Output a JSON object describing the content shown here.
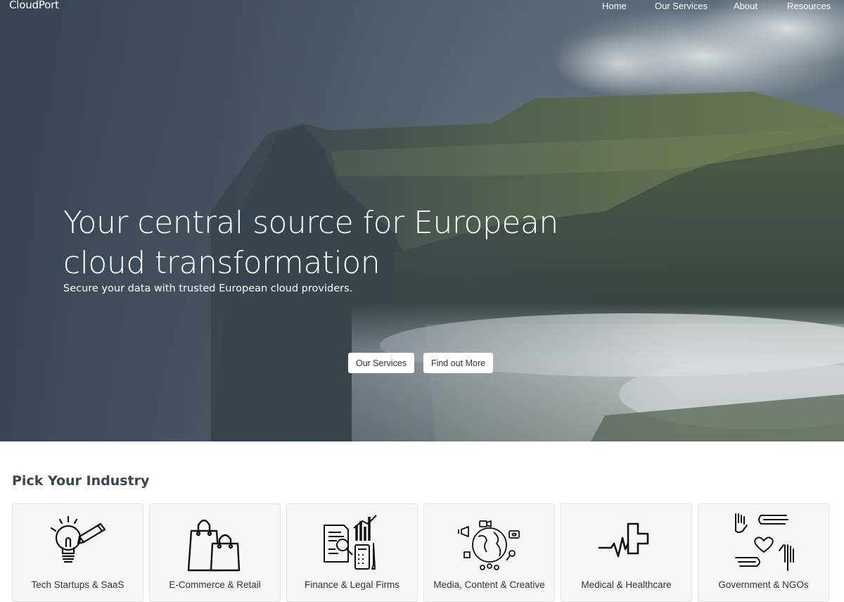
{
  "brand": {
    "name": "CloudPort"
  },
  "nav": {
    "items": [
      {
        "label": "Home"
      },
      {
        "label": "Our Services"
      },
      {
        "label": "About"
      },
      {
        "label": "Resources"
      }
    ]
  },
  "hero": {
    "headline": "Your central source for European cloud transformation",
    "subline": "Secure your data with trusted European cloud providers.",
    "primary_button": "Our Services",
    "secondary_button": "Find out More"
  },
  "industries": {
    "title": "Pick Your Industry",
    "items": [
      {
        "label": "Tech Startups & SaaS",
        "icon": "lightbulb-pencil-icon"
      },
      {
        "label": "E-Commerce & Retail",
        "icon": "shopping-bags-icon"
      },
      {
        "label": "Finance & Legal Firms",
        "icon": "finance-documents-icon"
      },
      {
        "label": "Media, Content & Creative",
        "icon": "media-globe-icon"
      },
      {
        "label": "Medical & Healthcare",
        "icon": "medical-cross-icon"
      },
      {
        "label": "Government & NGOs",
        "icon": "helping-hands-icon"
      }
    ]
  }
}
